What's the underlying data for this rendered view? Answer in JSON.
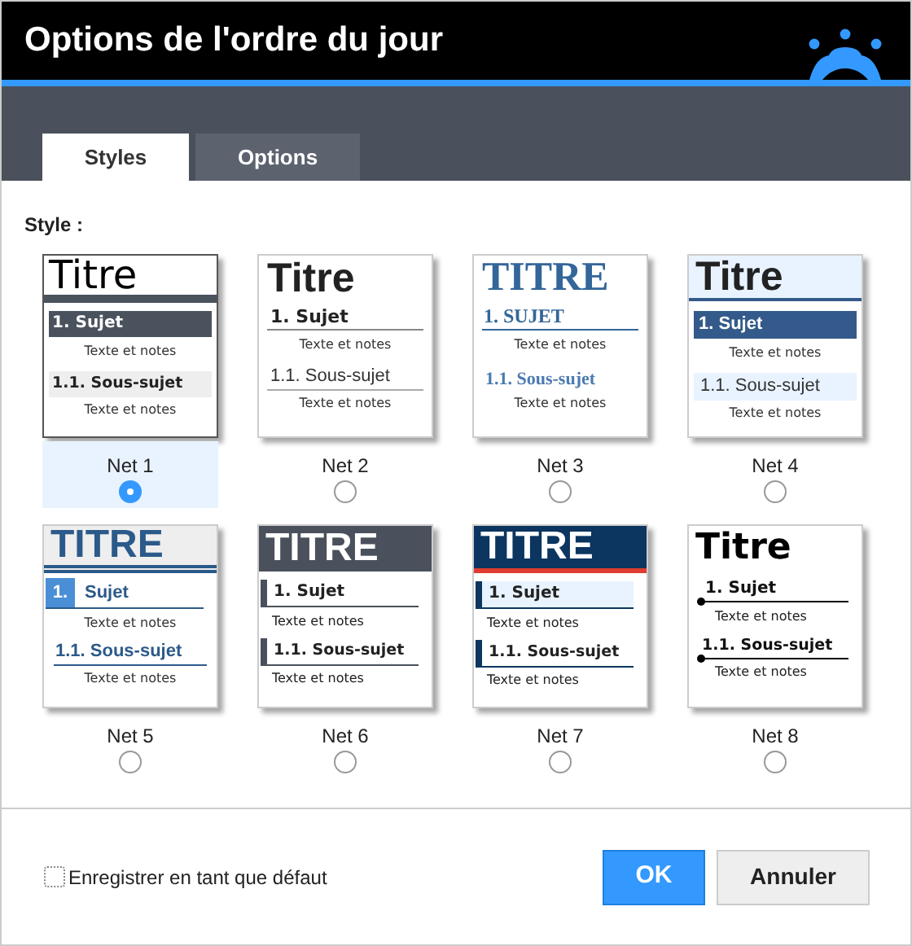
{
  "window": {
    "title": "Options de l'ordre du jour"
  },
  "tabs": [
    {
      "label": "Styles",
      "selected": true
    },
    {
      "label": "Options",
      "selected": false
    }
  ],
  "style_label": "Style :",
  "styles": [
    {
      "kind": "net1",
      "name": "Net 1",
      "selected": true,
      "title": "Titre",
      "topic": "1. Sujet",
      "notes": "Texte et notes",
      "subtopic": "1.1. Sous-sujet",
      "subnotes": "Texte et notes"
    },
    {
      "kind": "net2",
      "name": "Net 2",
      "selected": false,
      "title": "Titre",
      "topic": "1. Sujet",
      "notes": "Texte et notes",
      "subtopic": "1.1. Sous-sujet",
      "subnotes": "Texte et notes"
    },
    {
      "kind": "net3",
      "name": "Net 3",
      "selected": false,
      "title": "TITRE",
      "topic": "1. SUJET",
      "notes": "Texte et notes",
      "subtopic": "1.1. Sous-sujet",
      "subnotes": "Texte et notes"
    },
    {
      "kind": "net4",
      "name": "Net 4",
      "selected": false,
      "title": "Titre",
      "topic": "1. Sujet",
      "notes": "Texte et notes",
      "subtopic": "1.1. Sous-sujet",
      "subnotes": "Texte et notes"
    },
    {
      "kind": "net5",
      "name": "Net 5",
      "selected": false,
      "title": "TITRE",
      "topic_number": "1.",
      "topic": "Sujet",
      "notes": "Texte et notes",
      "subtopic": "1.1. Sous-sujet",
      "subnotes": "Texte et notes"
    },
    {
      "kind": "net6",
      "name": "Net 6",
      "selected": false,
      "title": "TITRE",
      "topic": "1. Sujet",
      "notes": "Texte et notes",
      "subtopic": "1.1. Sous-sujet",
      "subnotes": "Texte et notes"
    },
    {
      "kind": "net7",
      "name": "Net 7",
      "selected": false,
      "title": "TITRE",
      "topic": "1. Sujet",
      "notes": "Texte et notes",
      "subtopic": "1.1. Sous-sujet",
      "subnotes": "Texte et notes"
    },
    {
      "kind": "net8",
      "name": "Net 8",
      "selected": false,
      "title": "Titre",
      "topic": "1. Sujet",
      "notes": "Texte et notes",
      "subtopic": "1.1. Sous-sujet",
      "subnotes": "Texte et notes"
    }
  ],
  "save_default": {
    "label": "Enregistrer en tant que défaut",
    "checked": false
  },
  "buttons": [
    {
      "label": "OK",
      "kind": "primary"
    },
    {
      "label": "Annuler",
      "kind": "secondary"
    }
  ]
}
